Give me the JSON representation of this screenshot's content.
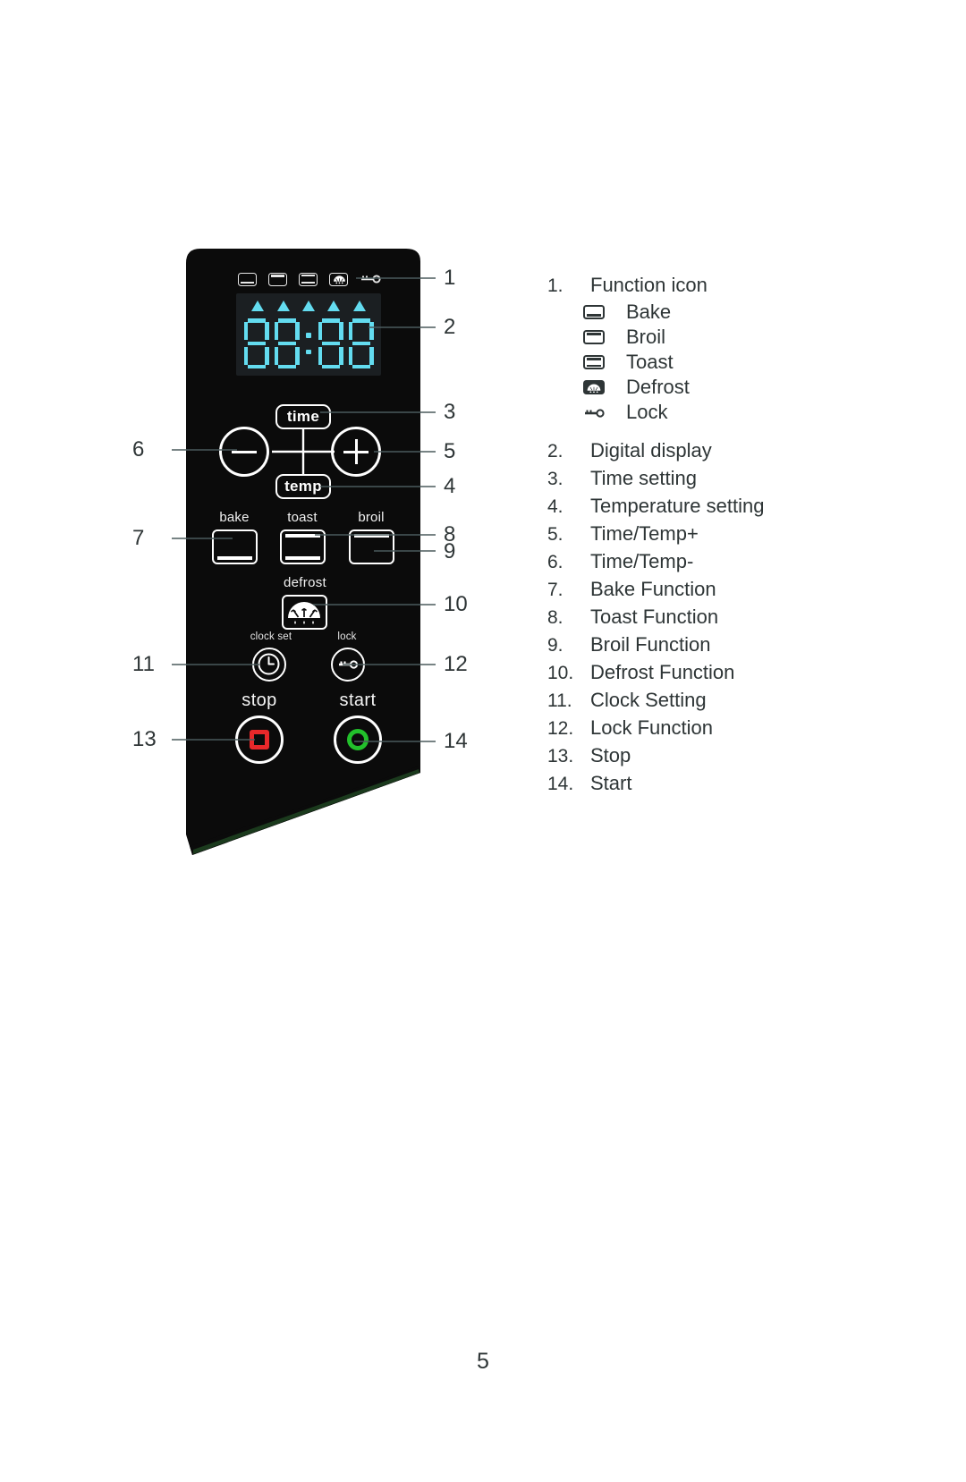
{
  "page": {
    "number": "5"
  },
  "display": {
    "digits": [
      "8",
      "8",
      "8",
      "8"
    ],
    "colon": ":",
    "indicator_triangles": 5,
    "segment_color": "#63dcf0",
    "screen_bg": "#1b1f22"
  },
  "panel": {
    "background": "#0b0b0b",
    "indicator_icons": [
      {
        "name": "bake-indicator-icon",
        "label": "Bake"
      },
      {
        "name": "broil-indicator-icon",
        "label": "Broil"
      },
      {
        "name": "toast-indicator-icon",
        "label": "Toast"
      },
      {
        "name": "defrost-indicator-icon",
        "label": "Defrost"
      },
      {
        "name": "lock-indicator-icon",
        "label": "Lock"
      }
    ],
    "pills": {
      "time": "time",
      "temp": "temp"
    },
    "mode_labels": {
      "bake": "bake",
      "toast": "toast",
      "broil": "broil"
    },
    "defrost_label": "defrost",
    "clock_set_label": "clock set",
    "lock_label": "lock",
    "stop_label": "stop",
    "start_label": "start",
    "stop_color": "#e8282a",
    "start_color": "#22c02b"
  },
  "callouts": [
    {
      "num": "1",
      "target": "lock-indicator-icon"
    },
    {
      "num": "2",
      "target": "digital-display"
    },
    {
      "num": "3",
      "target": "time-pill"
    },
    {
      "num": "4",
      "target": "temp-pill"
    },
    {
      "num": "5",
      "target": "plus-button"
    },
    {
      "num": "6",
      "target": "minus-button"
    },
    {
      "num": "7",
      "target": "bake-button"
    },
    {
      "num": "8",
      "target": "toast-button"
    },
    {
      "num": "9",
      "target": "broil-button"
    },
    {
      "num": "10",
      "target": "defrost-button"
    },
    {
      "num": "11",
      "target": "clock-set-button"
    },
    {
      "num": "12",
      "target": "lock-button"
    },
    {
      "num": "13",
      "target": "stop-button"
    },
    {
      "num": "14",
      "target": "start-button"
    }
  ],
  "legend": {
    "items": [
      {
        "num": "1.",
        "text": "Function icon"
      },
      {
        "num": "2.",
        "text": "Digital display"
      },
      {
        "num": "3.",
        "text": "Time setting"
      },
      {
        "num": "4.",
        "text": "Temperature setting"
      },
      {
        "num": "5.",
        "text": "Time/Temp+"
      },
      {
        "num": "6.",
        "text": "Time/Temp-"
      },
      {
        "num": "7.",
        "text": "Bake Function"
      },
      {
        "num": "8.",
        "text": "Toast Function"
      },
      {
        "num": "9.",
        "text": "Broil Function"
      },
      {
        "num": "10.",
        "text": "Defrost Function"
      },
      {
        "num": "11.",
        "text": "Clock Setting"
      },
      {
        "num": "12.",
        "text": "Lock Function"
      },
      {
        "num": "13.",
        "text": "Stop"
      },
      {
        "num": "14.",
        "text": "Start"
      }
    ],
    "function_icons": [
      {
        "icon": "bake-icon",
        "label": "Bake"
      },
      {
        "icon": "broil-icon",
        "label": "Broil"
      },
      {
        "icon": "toast-icon",
        "label": "Toast"
      },
      {
        "icon": "defrost-icon",
        "label": "Defrost"
      },
      {
        "icon": "lock-icon",
        "label": "Lock"
      }
    ]
  }
}
